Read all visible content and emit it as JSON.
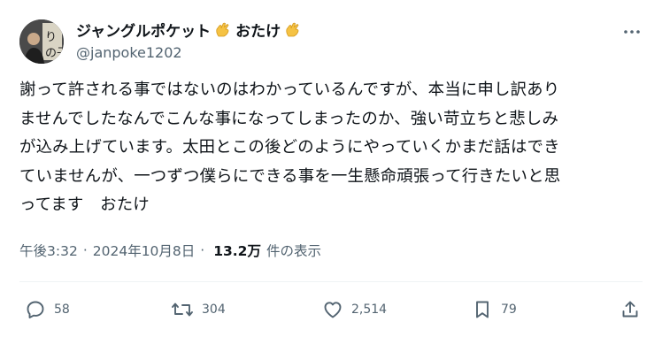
{
  "author": {
    "display_name": "ジャングルポケット",
    "name_suffix": "おたけ",
    "handle": "@janpoke1202",
    "avatar_icon": "avatar-photo-icon",
    "emoji_icon": "pinching-hand-emoji-icon"
  },
  "tweet": {
    "lines": [
      "謝って許される事ではないのはわかっているんですが、本当に申し訳あり",
      "ませんでしたなんでこんな事になってしまったのか、強い苛立ちと悲しみ",
      "が込み上げています。太田とこの後どのようにやっていくかまだ話はでき",
      "ていませんが、一つずつ僕らにできる事を一生懸命頑張って行きたいと思",
      "ってます　おたけ"
    ]
  },
  "meta": {
    "time": "午後3:32",
    "separator": "·",
    "date": "2024年10月8日",
    "views_count": "13.2万",
    "views_label": "件の表示"
  },
  "actions": {
    "replies": "58",
    "reposts": "304",
    "likes": "2,514",
    "bookmarks": "79"
  },
  "colors": {
    "text": "#0f1419",
    "secondary": "#536471",
    "divider": "#eff3f4",
    "emoji": "#f5c243"
  }
}
